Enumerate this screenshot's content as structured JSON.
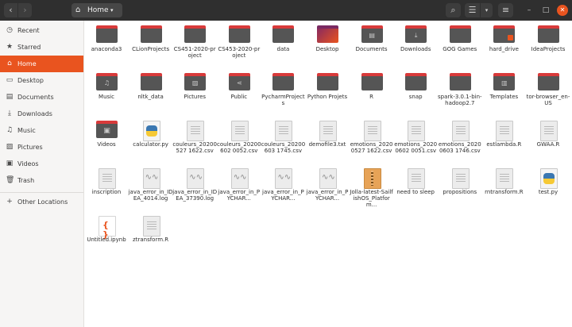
{
  "header": {
    "back_glyph": "‹",
    "forward_glyph": "›",
    "path_label": "Home",
    "home_glyph": "⌂",
    "chevron_glyph": "▾",
    "search_glyph": "⌕",
    "view_glyph": "☰",
    "menu_glyph": "≡",
    "minimize_glyph": "–",
    "maximize_glyph": "□",
    "close_glyph": "✕"
  },
  "sidebar": {
    "items": [
      {
        "label": "Recent",
        "icon": "clock-icon",
        "glyph": "◷",
        "active": false
      },
      {
        "label": "Starred",
        "icon": "star-icon",
        "glyph": "★",
        "active": false
      },
      {
        "label": "Home",
        "icon": "home-icon",
        "glyph": "⌂",
        "active": true
      },
      {
        "label": "Desktop",
        "icon": "desktop-icon",
        "glyph": "▭",
        "active": false
      },
      {
        "label": "Documents",
        "icon": "document-icon",
        "glyph": "▤",
        "active": false
      },
      {
        "label": "Downloads",
        "icon": "download-icon",
        "glyph": "⤓",
        "active": false
      },
      {
        "label": "Music",
        "icon": "music-icon",
        "glyph": "♫",
        "active": false
      },
      {
        "label": "Pictures",
        "icon": "picture-icon",
        "glyph": "▨",
        "active": false
      },
      {
        "label": "Videos",
        "icon": "video-icon",
        "glyph": "▣",
        "active": false
      },
      {
        "label": "Trash",
        "icon": "trash-icon",
        "glyph": "🗑",
        "active": false
      },
      {
        "label": "Other Locations",
        "icon": "plus-icon",
        "glyph": "+",
        "active": false
      }
    ]
  },
  "files": [
    {
      "name": "anaconda3",
      "kind": "folder",
      "emblem": ""
    },
    {
      "name": "CLionProjects",
      "kind": "folder",
      "emblem": ""
    },
    {
      "name": "CS451-2020-project",
      "kind": "folder",
      "emblem": ""
    },
    {
      "name": "CS453-2020-project",
      "kind": "folder",
      "emblem": ""
    },
    {
      "name": "data",
      "kind": "folder",
      "emblem": ""
    },
    {
      "name": "Desktop",
      "kind": "folder-desktop",
      "emblem": ""
    },
    {
      "name": "Documents",
      "kind": "folder",
      "emblem": "▤"
    },
    {
      "name": "Downloads",
      "kind": "folder",
      "emblem": "⤓"
    },
    {
      "name": "GOG Games",
      "kind": "folder",
      "emblem": ""
    },
    {
      "name": "hard_drive",
      "kind": "folder-locked",
      "emblem": ""
    },
    {
      "name": "IdeaProjects",
      "kind": "folder",
      "emblem": ""
    },
    {
      "name": "Music",
      "kind": "folder",
      "emblem": "♫"
    },
    {
      "name": "nltk_data",
      "kind": "folder",
      "emblem": ""
    },
    {
      "name": "Pictures",
      "kind": "folder",
      "emblem": "▨"
    },
    {
      "name": "Public",
      "kind": "folder",
      "emblem": "⋖"
    },
    {
      "name": "PycharmProjects",
      "kind": "folder",
      "emblem": ""
    },
    {
      "name": "Python Projets",
      "kind": "folder",
      "emblem": ""
    },
    {
      "name": "R",
      "kind": "folder",
      "emblem": ""
    },
    {
      "name": "snap",
      "kind": "folder",
      "emblem": ""
    },
    {
      "name": "spark-3.0.1-bin-hadoop2.7",
      "kind": "folder",
      "emblem": ""
    },
    {
      "name": "Templates",
      "kind": "folder",
      "emblem": "▥"
    },
    {
      "name": "tor-browser_en-US",
      "kind": "folder",
      "emblem": ""
    },
    {
      "name": "Videos",
      "kind": "folder-videos",
      "emblem": "▣"
    },
    {
      "name": "calculator.py",
      "kind": "python",
      "emblem": ""
    },
    {
      "name": "couleurs_20200527 1622.csv",
      "kind": "doc",
      "emblem": ""
    },
    {
      "name": "couleurs_20200602 0052.csv",
      "kind": "doc",
      "emblem": ""
    },
    {
      "name": "couleurs_20200603 1745.csv",
      "kind": "doc",
      "emblem": ""
    },
    {
      "name": "demofile3.txt",
      "kind": "doc",
      "emblem": ""
    },
    {
      "name": "emotions_20200527 1622.csv",
      "kind": "doc",
      "emblem": ""
    },
    {
      "name": "emotions_20200602 0051.csv",
      "kind": "doc",
      "emblem": ""
    },
    {
      "name": "emotions_20200603 1746.csv",
      "kind": "doc",
      "emblem": ""
    },
    {
      "name": "estlambda.R",
      "kind": "doc",
      "emblem": ""
    },
    {
      "name": "GWAA.R",
      "kind": "doc",
      "emblem": ""
    },
    {
      "name": "inscription",
      "kind": "doc",
      "emblem": ""
    },
    {
      "name": "java_error_in_IDEA_4014.log",
      "kind": "log",
      "emblem": ""
    },
    {
      "name": "java_error_in_IDEA_37390.log",
      "kind": "log",
      "emblem": ""
    },
    {
      "name": "java_error_in_PYCHAR...",
      "kind": "log",
      "emblem": ""
    },
    {
      "name": "java_error_in_PYCHAR...",
      "kind": "log",
      "emblem": ""
    },
    {
      "name": "java_error_in_PYCHAR...",
      "kind": "log",
      "emblem": ""
    },
    {
      "name": "Jolla-latest-SailfishOS_Platform...",
      "kind": "archive",
      "emblem": ""
    },
    {
      "name": "need to sleep",
      "kind": "doc",
      "emblem": ""
    },
    {
      "name": "propositions",
      "kind": "doc",
      "emblem": ""
    },
    {
      "name": "rntransform.R",
      "kind": "doc",
      "emblem": ""
    },
    {
      "name": "test.py",
      "kind": "python",
      "emblem": ""
    },
    {
      "name": "Untitled.ipynb",
      "kind": "notebook",
      "emblem": ""
    },
    {
      "name": "ztransform.R",
      "kind": "doc",
      "emblem": ""
    }
  ]
}
